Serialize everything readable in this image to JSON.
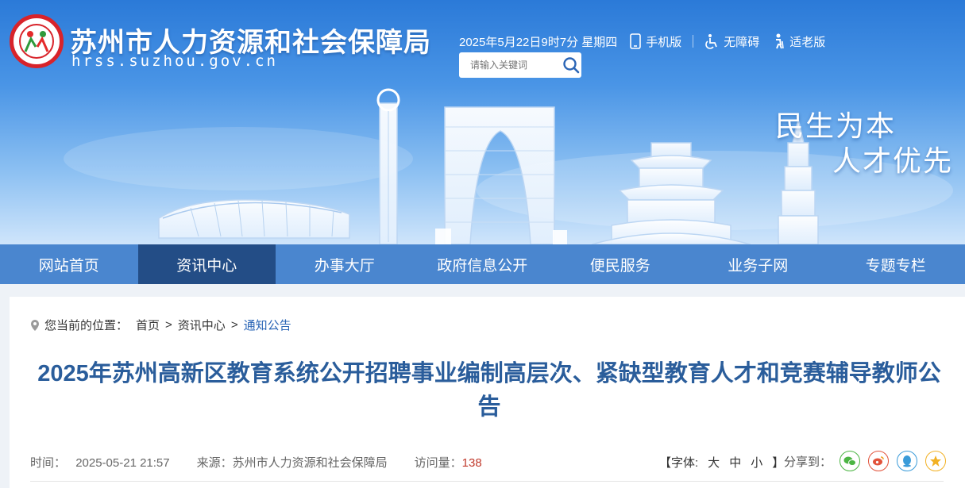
{
  "header": {
    "site_title": "苏州市人力资源和社会保障局",
    "site_domain": "hrss.suzhou.gov.cn",
    "datetime": "2025年5月22日9时7分 星期四",
    "mobile_label": "手机版",
    "accessibility_label": "无障碍",
    "elderly_label": "适老版",
    "search_placeholder": "请输入关键词",
    "slogan_line1": "民生为本",
    "slogan_line2": "人才优先"
  },
  "nav": {
    "items": [
      {
        "label": "网站首页"
      },
      {
        "label": "资讯中心"
      },
      {
        "label": "办事大厅"
      },
      {
        "label": "政府信息公开"
      },
      {
        "label": "便民服务"
      },
      {
        "label": "业务子网"
      },
      {
        "label": "专题专栏"
      }
    ],
    "active_index": 1
  },
  "breadcrumb": {
    "prefix": "您当前的位置：",
    "items": [
      "首页",
      "资讯中心",
      "通知公告"
    ],
    "separator": ">"
  },
  "article": {
    "title": "2025年苏州高新区教育系统公开招聘事业编制高层次、紧缺型教育人才和竞赛辅导教师公告",
    "time_label": "时间：",
    "time_value": "2025-05-21 21:57",
    "source_label": "来源：",
    "source_value": "苏州市人力资源和社会保障局",
    "views_label": "访问量：",
    "views_value": "138",
    "font_open": "【字体:",
    "font_large": "大",
    "font_medium": "中",
    "font_small": "小",
    "font_close": "】",
    "share_label": "分享到："
  },
  "colors": {
    "nav_bg": "#4a86cf",
    "nav_active": "#234d86",
    "title_blue": "#2a5d9b",
    "views_red": "#c0392b"
  },
  "icons": [
    "phone-icon",
    "wheelchair-icon",
    "elderly-icon",
    "search-icon",
    "location-pin-icon",
    "wechat-icon",
    "weibo-icon",
    "qq-icon",
    "qzone-icon"
  ]
}
